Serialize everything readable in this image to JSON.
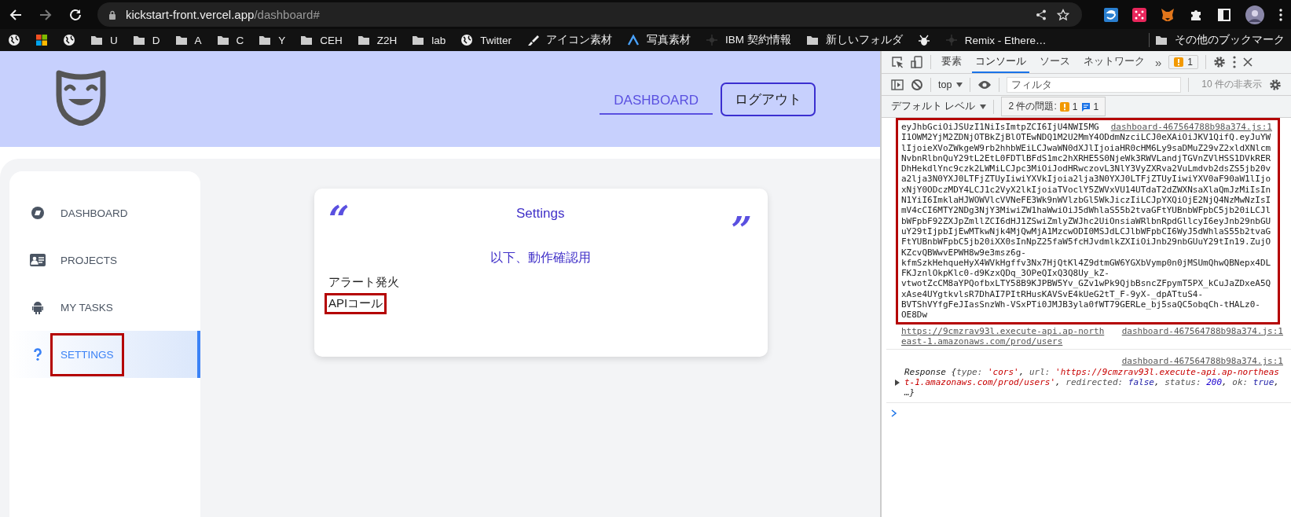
{
  "browser": {
    "url_host": "kickstart-front.vercel.app",
    "url_path": "/dashboard#"
  },
  "bookmarks": [
    {
      "kind": "globe"
    },
    {
      "kind": "tiles"
    },
    {
      "kind": "globe"
    },
    {
      "kind": "folder",
      "label": "U"
    },
    {
      "kind": "folder",
      "label": "D"
    },
    {
      "kind": "folder",
      "label": "A"
    },
    {
      "kind": "folder",
      "label": "C"
    },
    {
      "kind": "folder",
      "label": "Y"
    },
    {
      "kind": "folder",
      "label": "CEH"
    },
    {
      "kind": "folder",
      "label": "Z2H"
    },
    {
      "kind": "folder",
      "label": "lab"
    },
    {
      "kind": "globe",
      "label": "Twitter"
    },
    {
      "kind": "brush",
      "label": "アイコン素材"
    },
    {
      "kind": "peak",
      "label": "写真素材"
    },
    {
      "kind": "dots",
      "label": "IBM 契約情報"
    },
    {
      "kind": "folder",
      "label": "新しいフォルダ"
    },
    {
      "kind": "bug"
    },
    {
      "kind": "dots",
      "label": "Remix - Ethere…"
    }
  ],
  "other_bookmarks": "その他のブックマーク",
  "app": {
    "nav": [
      {
        "label": "DASHBOARD",
        "selected": true
      }
    ],
    "logout": "ログアウト",
    "sidebar": [
      {
        "label": "DASHBOARD",
        "selected": false,
        "annotated": false
      },
      {
        "label": "PROJECTS",
        "selected": false,
        "annotated": false
      },
      {
        "label": "MY TASKS",
        "selected": false,
        "annotated": false
      },
      {
        "label": "SETTINGS",
        "selected": true,
        "annotated": true
      }
    ],
    "card": {
      "open_quote": "“",
      "title": "Settings",
      "close_quote": "”",
      "subtitle": "以下、動作確認用",
      "links": [
        {
          "label": "アラート発火",
          "annotated": false
        },
        {
          "label": "APIコール",
          "annotated": true
        }
      ]
    }
  },
  "devtools": {
    "tabs": [
      {
        "label": "要素",
        "selected": false
      },
      {
        "label": "コンソール",
        "selected": true
      },
      {
        "label": "ソース",
        "selected": false
      },
      {
        "label": "ネットワーク",
        "selected": false
      }
    ],
    "more": "»",
    "issues_badge": "1",
    "context": "top",
    "filter_placeholder": "フィルタ",
    "hidden_count": "10 件の非表示",
    "level": "デフォルト レベル",
    "issues_label": "2 件の問題:",
    "warnings": "1",
    "infos": "1",
    "messages": [
      {
        "kind": "text",
        "annotated": true,
        "source": "dashboard-467564788b98a374.js:1",
        "text": "eyJhbGciOiJSUzI1NiIsImtpZCI6IjU4NWI5MGI1OWM2YjM2ZDNjOTBkZjBlOTEwNDQ1M2U2MmY4ODdmNzciLCJ0eXAiOiJKV1QifQ.eyJuYWlIjoieXVoZWkgeW9rb2hhbWEiLCJwaWN0dXJlIjoiaHR0cHM6Ly9saDMuZ29vZ2xldXNlcmNvbnRlbnQuY29tL2EtL0FDTlBFdS1mc2hXRHE5S0NjeWk3RWVLandjTGVnZVlHSS1DVkRERDhHekdlYnc9czk2LWMiLCJpc3MiOiJodHRwczovL3NlY3VyZXRva2VuLmdvb2dsZS5jb20va2lja3N0YXJ0LTFjZTUyIiwiYXVkIjoia2lja3N0YXJ0LTFjZTUyIiwiYXV0aF90aW1lIjoxNjY0ODczMDY4LCJ1c2VyX2lkIjoiaTVoclY5ZWVxVU14UTdaT2dZWXNsaXlaQmJzMiIsInN1YiI6ImklaHJWOWVlcVVNeFE3Wk9nWVlzbGl5WkJiczIiLCJpYXQiOjE2NjQ4NzMwNzIsImV4cCI6MTY2NDg3NjY3MiwiZW1haWwiOiJ5dWhlaS55b2tvaGFtYUBnbWFpbC5jb20iLCJlbWFpbF92ZXJpZmllZCI6dHJ1ZSwiZmlyZWJhc2UiOnsiaWRlbnRpdGllcyI6eyJnb29nbGUuY29tIjpbIjEwMTkwNjk4MjQwMjA1MzcwODI0MSJdLCJlbWFpbCI6WyJ5dWhlaS55b2tvaGFtYUBnbWFpbC5jb20iXX0sInNpZ25faW5fcHJvdmlkZXIiOiJnb29nbGUuY29tIn19.ZujOKZcvQBWwvEPWH8w9e3msz6g-kfmSzkHehqueHyX4WVkHgffv3Nx7HjQtKl4Z9dtmGW6YGXbVymp0n0jMSUmQhwQBNepx4DLFKJznlOkpKlc0-d9KzxQDq_3OPeQIxQ3Q8Uy_kZ-vtwotZcCM8aYPQofbxLTY58B9KJPBW5Yv_GZv1wPk9QjbBsncZFpymT5PX_kCuJaZDxeA5QxAse4UYgtkvlsR7DhAI7PItRHusKAVSvE4kUeG2tT_F-9yX-_dpATtuS4-BVTShVYfgFeJIasSnzWh-VSxPTi0JMJB3yla0fWT79GERLe_bj5saQC5obqCh-tHALz0-OE8Dw"
      },
      {
        "kind": "link",
        "annotated": false,
        "source": "dashboard-467564788b98a374.js:1",
        "text": "https://9cmzrav93l.execute-api.ap-northeast-1.amazonaws.com/prod/users"
      },
      {
        "kind": "object",
        "annotated": false,
        "source": "dashboard-467564788b98a374.js:1",
        "parts": [
          {
            "text": "Response ",
            "kind": "plain"
          },
          {
            "text": "{",
            "kind": "plain"
          },
          {
            "text": "type: ",
            "kind": "key"
          },
          {
            "text": "'cors'",
            "kind": "string"
          },
          {
            "text": ", ",
            "kind": "plain"
          },
          {
            "text": "url: ",
            "kind": "key"
          },
          {
            "text": "'https://9cmzrav93l.execute-api.ap-northeast-1.amazonaws.com/prod/users'",
            "kind": "string"
          },
          {
            "text": ", ",
            "kind": "plain"
          },
          {
            "text": "redirected: ",
            "kind": "key"
          },
          {
            "text": "false",
            "kind": "keyword"
          },
          {
            "text": ", ",
            "kind": "plain"
          },
          {
            "text": "status: ",
            "kind": "key"
          },
          {
            "text": "200",
            "kind": "number"
          },
          {
            "text": ", ",
            "kind": "plain"
          },
          {
            "text": "ok: ",
            "kind": "key"
          },
          {
            "text": "true",
            "kind": "keyword"
          },
          {
            "text": ", …}",
            "kind": "plain"
          }
        ]
      }
    ]
  }
}
